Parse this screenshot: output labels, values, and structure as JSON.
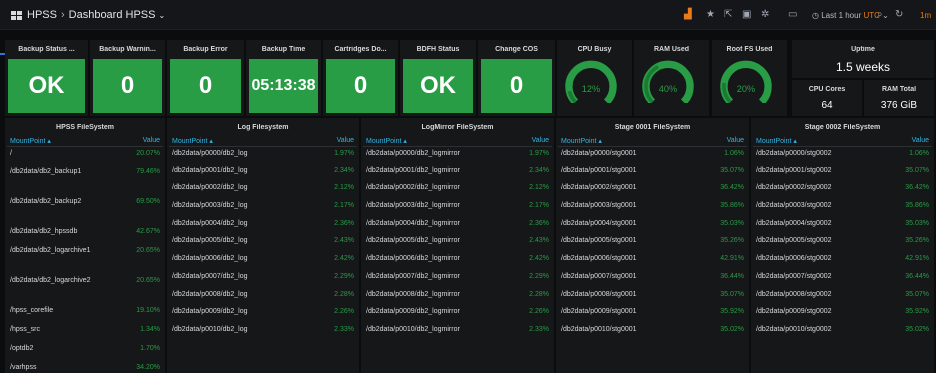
{
  "header": {
    "title": "HPSS",
    "dashboard": "Dashboard HPSS",
    "time_range": "Last 1 hour",
    "timezone": "UTC",
    "refresh": "1m"
  },
  "singlestats": [
    {
      "title": "Backup Status ...",
      "value": "OK"
    },
    {
      "title": "Backup Warnin...",
      "value": "0"
    },
    {
      "title": "Backup Error",
      "value": "0"
    },
    {
      "title": "Backup Time",
      "value": "05:13:38"
    },
    {
      "title": "Cartridges Do...",
      "value": "0"
    },
    {
      "title": "BDFH Status",
      "value": "OK"
    },
    {
      "title": "Change COS",
      "value": "0"
    }
  ],
  "gauges": [
    {
      "title": "CPU Busy",
      "value": "12%",
      "level": 0.12
    },
    {
      "title": "RAM Used",
      "value": "40%",
      "level": 0.4
    },
    {
      "title": "Root FS Used",
      "value": "20%",
      "level": 0.2
    }
  ],
  "uptime": {
    "title": "Uptime",
    "value": "1.5 weeks"
  },
  "cpu_cores": {
    "title": "CPU Cores",
    "value": "64"
  },
  "ram_total": {
    "title": "RAM Total",
    "value": "376 GiB"
  },
  "colors": {
    "green": "#299c46",
    "link": "#33b5e5",
    "accent": "#eb7b18"
  },
  "tables": [
    {
      "title": "HPSS FileSystem",
      "col1": "MountPoint ▴",
      "col2": "Value",
      "rows": [
        [
          "/",
          "20.07%"
        ],
        [
          "/db2data/db2_backup1",
          "79.46%"
        ],
        [
          "/db2data/db2_backup2",
          "69.50%"
        ],
        [
          "/db2data/db2_hpssdb",
          "42.67%"
        ],
        [
          "/db2data/db2_logarchive1",
          "20.65%"
        ],
        [
          "/db2data/db2_logarchive2",
          "20.65%"
        ],
        [
          "/hpss_corefile",
          "19.10%"
        ],
        [
          "/hpss_src",
          "1.34%"
        ],
        [
          "/optdb2",
          "1.70%"
        ],
        [
          "/varhpss",
          "34.20%"
        ]
      ]
    },
    {
      "title": "Log Filesystem",
      "col1": "MountPoint ▴",
      "col2": "Value",
      "rows": [
        [
          "/db2data/p0000/db2_log",
          "1.97%"
        ],
        [
          "/db2data/p0001/db2_log",
          "2.34%"
        ],
        [
          "/db2data/p0002/db2_log",
          "2.12%"
        ],
        [
          "/db2data/p0003/db2_log",
          "2.17%"
        ],
        [
          "/db2data/p0004/db2_log",
          "2.36%"
        ],
        [
          "/db2data/p0005/db2_log",
          "2.43%"
        ],
        [
          "/db2data/p0006/db2_log",
          "2.42%"
        ],
        [
          "/db2data/p0007/db2_log",
          "2.29%"
        ],
        [
          "/db2data/p0008/db2_log",
          "2.28%"
        ],
        [
          "/db2data/p0009/db2_log",
          "2.26%"
        ],
        [
          "/db2data/p0010/db2_log",
          "2.33%"
        ]
      ]
    },
    {
      "title": "LogMirror FileSystem",
      "col1": "MountPoint ▴",
      "col2": "Value",
      "rows": [
        [
          "/db2data/p0000/db2_logmirror",
          "1.97%"
        ],
        [
          "/db2data/p0001/db2_logmirror",
          "2.34%"
        ],
        [
          "/db2data/p0002/db2_logmirror",
          "2.12%"
        ],
        [
          "/db2data/p0003/db2_logmirror",
          "2.17%"
        ],
        [
          "/db2data/p0004/db2_logmirror",
          "2.36%"
        ],
        [
          "/db2data/p0005/db2_logmirror",
          "2.43%"
        ],
        [
          "/db2data/p0006/db2_logmirror",
          "2.42%"
        ],
        [
          "/db2data/p0007/db2_logmirror",
          "2.29%"
        ],
        [
          "/db2data/p0008/db2_logmirror",
          "2.28%"
        ],
        [
          "/db2data/p0009/db2_logmirror",
          "2.26%"
        ],
        [
          "/db2data/p0010/db2_logmirror",
          "2.33%"
        ]
      ]
    },
    {
      "title": "Stage 0001 FileSystem",
      "col1": "MountPoint ▴",
      "col2": "Value",
      "rows": [
        [
          "/db2data/p0000/stg0001",
          "1.06%"
        ],
        [
          "/db2data/p0001/stg0001",
          "35.07%"
        ],
        [
          "/db2data/p0002/stg0001",
          "36.42%"
        ],
        [
          "/db2data/p0003/stg0001",
          "35.86%"
        ],
        [
          "/db2data/p0004/stg0001",
          "35.03%"
        ],
        [
          "/db2data/p0005/stg0001",
          "35.26%"
        ],
        [
          "/db2data/p0006/stg0001",
          "42.91%"
        ],
        [
          "/db2data/p0007/stg0001",
          "36.44%"
        ],
        [
          "/db2data/p0008/stg0001",
          "35.07%"
        ],
        [
          "/db2data/p0009/stg0001",
          "35.92%"
        ],
        [
          "/db2data/p0010/stg0001",
          "35.02%"
        ]
      ]
    },
    {
      "title": "Stage 0002 FileSystem",
      "col1": "MountPoint ▴",
      "col2": "Value",
      "rows": [
        [
          "/db2data/p0000/stg0002",
          "1.06%"
        ],
        [
          "/db2data/p0001/stg0002",
          "35.07%"
        ],
        [
          "/db2data/p0002/stg0002",
          "36.42%"
        ],
        [
          "/db2data/p0003/stg0002",
          "35.86%"
        ],
        [
          "/db2data/p0004/stg0002",
          "35.03%"
        ],
        [
          "/db2data/p0005/stg0002",
          "35.26%"
        ],
        [
          "/db2data/p0006/stg0002",
          "42.91%"
        ],
        [
          "/db2data/p0007/stg0002",
          "36.44%"
        ],
        [
          "/db2data/p0008/stg0002",
          "35.07%"
        ],
        [
          "/db2data/p0009/stg0002",
          "35.92%"
        ],
        [
          "/db2data/p0010/stg0002",
          "35.02%"
        ]
      ]
    }
  ]
}
